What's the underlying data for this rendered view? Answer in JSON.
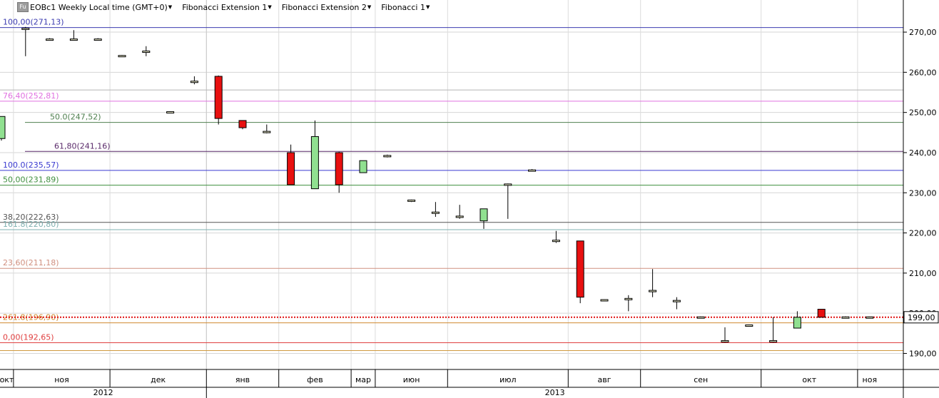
{
  "header": {
    "icon_label": "Fu",
    "instrument": "EOBc1 Weekly Local time (GMT+0)",
    "studies": [
      "Fibonacci Extension 1",
      "Fibonacci Extension 2",
      "Fibonacci 1"
    ]
  },
  "chart_data": {
    "type": "candlestick",
    "title": "EOBc1 Weekly Local time (GMT+0)",
    "ylim": [
      186.0,
      278.0
    ],
    "y_ticks": [
      190,
      200,
      210,
      220,
      230,
      240,
      250,
      260,
      270
    ],
    "y_tick_labels": [
      "190,00",
      "200,00",
      "210,00",
      "220,00",
      "230,00",
      "240,00",
      "250,00",
      "260,00",
      "270,00"
    ],
    "current_price": {
      "value": 199.0,
      "label": "199,00"
    },
    "x_months": [
      {
        "label": "окт",
        "start": 0,
        "end": 1
      },
      {
        "label": "ноя",
        "start": 1,
        "end": 5
      },
      {
        "label": "дек",
        "start": 5,
        "end": 9
      },
      {
        "label": "янв",
        "start": 9,
        "end": 12
      },
      {
        "label": "фев",
        "start": 12,
        "end": 15
      },
      {
        "label": "мар",
        "start": 15,
        "end": 16
      },
      {
        "label": "июн",
        "start": 16,
        "end": 19
      },
      {
        "label": "июл",
        "start": 19,
        "end": 24
      },
      {
        "label": "авг",
        "start": 24,
        "end": 27
      },
      {
        "label": "сен",
        "start": 27,
        "end": 32
      },
      {
        "label": "окт",
        "start": 32,
        "end": 36
      },
      {
        "label": "ноя",
        "start": 36,
        "end": 37
      }
    ],
    "x_years": [
      {
        "label": "2012",
        "start": 0,
        "end": 9
      },
      {
        "label": "2013",
        "start": 9,
        "end": 37
      }
    ],
    "candles": [
      {
        "o": 243.5,
        "h": 249.0,
        "l": 243.0,
        "c": 249.0
      },
      {
        "o": 271.0,
        "h": 271.3,
        "l": 264.0,
        "c": 271.0
      },
      {
        "o": 268.3,
        "h": 268.5,
        "l": 268.0,
        "c": 268.0
      },
      {
        "o": 268.3,
        "h": 270.5,
        "l": 268.0,
        "c": 268.0
      },
      {
        "o": 268.3,
        "h": 268.5,
        "l": 268.0,
        "c": 268.0
      },
      {
        "o": 264.0,
        "h": 264.3,
        "l": 263.8,
        "c": 264.2
      },
      {
        "o": 265.0,
        "h": 266.5,
        "l": 264.0,
        "c": 265.3
      },
      {
        "o": 250.0,
        "h": 250.3,
        "l": 249.8,
        "c": 250.2
      },
      {
        "o": 257.5,
        "h": 259.0,
        "l": 257.0,
        "c": 257.8
      },
      {
        "o": 259.0,
        "h": 259.2,
        "l": 247.0,
        "c": 248.5
      },
      {
        "o": 248.0,
        "h": 248.0,
        "l": 245.8,
        "c": 246.2
      },
      {
        "o": 245.0,
        "h": 247.0,
        "l": 244.8,
        "c": 245.3
      },
      {
        "o": 240.0,
        "h": 242.0,
        "l": 232.0,
        "c": 232.0
      },
      {
        "o": 231.0,
        "h": 248.0,
        "l": 231.0,
        "c": 244.0
      },
      {
        "o": 240.0,
        "h": 240.2,
        "l": 230.0,
        "c": 232.0
      },
      {
        "o": 235.0,
        "h": 238.0,
        "l": 235.0,
        "c": 238.0
      },
      {
        "o": 239.0,
        "h": 239.5,
        "l": 238.8,
        "c": 239.3
      },
      {
        "o": 228.0,
        "h": 228.3,
        "l": 227.7,
        "c": 228.2
      },
      {
        "o": 225.0,
        "h": 227.7,
        "l": 224.0,
        "c": 225.2
      },
      {
        "o": 224.0,
        "h": 227.0,
        "l": 223.5,
        "c": 224.2
      },
      {
        "o": 223.0,
        "h": 226.0,
        "l": 221.0,
        "c": 226.0
      },
      {
        "o": 232.0,
        "h": 232.3,
        "l": 223.5,
        "c": 232.2
      },
      {
        "o": 235.7,
        "h": 235.9,
        "l": 235.3,
        "c": 235.5
      },
      {
        "o": 218.0,
        "h": 220.5,
        "l": 217.5,
        "c": 218.2
      },
      {
        "o": 218.0,
        "h": 218.0,
        "l": 202.5,
        "c": 204.0
      },
      {
        "o": 203.3,
        "h": 203.5,
        "l": 203.0,
        "c": 203.4
      },
      {
        "o": 203.5,
        "h": 204.5,
        "l": 200.5,
        "c": 203.7
      },
      {
        "o": 205.5,
        "h": 211.0,
        "l": 204.0,
        "c": 205.7
      },
      {
        "o": 203.0,
        "h": 204.0,
        "l": 201.0,
        "c": 203.2
      },
      {
        "o": 199.0,
        "h": 199.2,
        "l": 198.8,
        "c": 199.1
      },
      {
        "o": 193.0,
        "h": 196.5,
        "l": 192.7,
        "c": 193.2
      },
      {
        "o": 197.0,
        "h": 197.2,
        "l": 196.8,
        "c": 197.1
      },
      {
        "o": 193.0,
        "h": 199.0,
        "l": 192.7,
        "c": 193.2
      },
      {
        "o": 196.3,
        "h": 200.5,
        "l": 196.3,
        "c": 199.0
      },
      {
        "o": 201.0,
        "h": 201.0,
        "l": 199.0,
        "c": 199.0
      },
      {
        "o": 199.0,
        "h": 199.2,
        "l": 198.8,
        "c": 199.1
      },
      {
        "o": 199.0,
        "h": 199.2,
        "l": 198.8,
        "c": 199.1
      }
    ],
    "fib_levels": [
      {
        "label": "100,00(271,13)",
        "value": 271.13,
        "color": "#3b3bb0",
        "start": 0
      },
      {
        "label": "",
        "value": 255.6,
        "color": "#b5b5b5",
        "start": 0
      },
      {
        "label": "76,40(252,81)",
        "value": 252.81,
        "color": "#e070e0",
        "start": 0
      },
      {
        "label": "50.0(247,52)",
        "value": 247.52,
        "color": "#4f7f4f",
        "start": 1
      },
      {
        "label": "61,80(241,16)",
        "value": 240.3,
        "color": "#5a2a6a",
        "start": 1
      },
      {
        "label": "100.0(235,57)",
        "value": 235.57,
        "color": "#3a3ad0",
        "start": 0
      },
      {
        "label": "50,00(231,89)",
        "value": 231.89,
        "color": "#3f8f3f",
        "start": 0
      },
      {
        "label": "38,20(222,63)",
        "value": 222.63,
        "color": "#555555",
        "start": 0
      },
      {
        "label": "161.8(220,80)",
        "value": 220.8,
        "color": "#7fb0b0",
        "start": 0
      },
      {
        "label": "23,60(211,18)",
        "value": 211.18,
        "color": "#d09080",
        "start": 0
      },
      {
        "label": "261.8(196,90)",
        "value": 197.6,
        "color": "#d08a30",
        "start": 0
      },
      {
        "label": "0,00(192,65)",
        "value": 192.65,
        "color": "#e04040",
        "start": 0
      },
      {
        "label": "",
        "value": 190.7,
        "color": "#d09a40",
        "start": 0
      }
    ],
    "colors": {
      "up": "#90e090",
      "down": "#e81010",
      "neutral": "#f0f0d0"
    }
  }
}
